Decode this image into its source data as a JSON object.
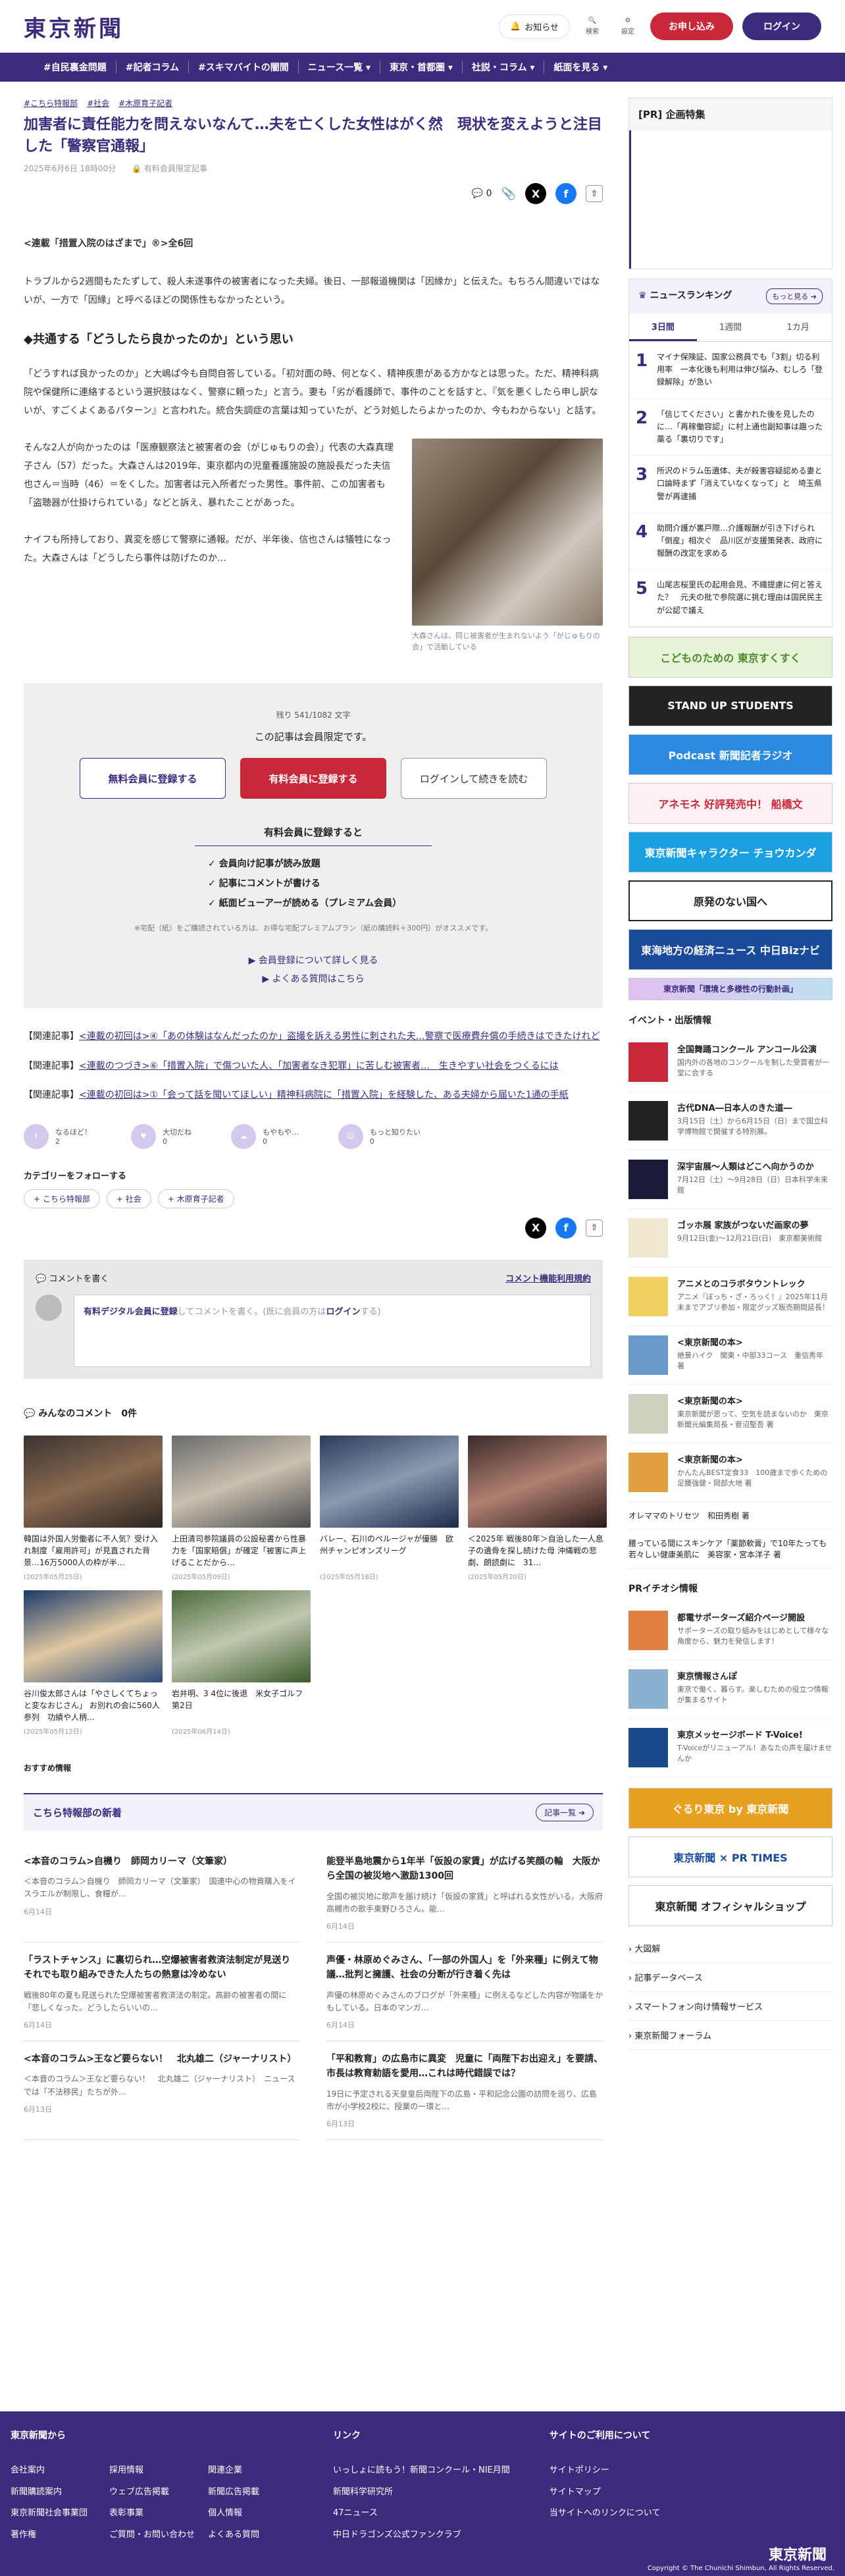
{
  "header": {
    "logo": "東京新聞",
    "notice": "お知らせ",
    "search": "検索",
    "settings": "設定",
    "apply": "お申し込み",
    "login": "ログイン"
  },
  "nav": [
    "#自民裏金問題",
    "#記者コラム",
    "#スキマバイトの闇間",
    "ニュース一覧 ▾",
    "東京・首都圏 ▾",
    "社説・コラム ▾",
    "紙面を見る ▾"
  ],
  "article": {
    "tags": [
      "#こちら特報部",
      "#社会",
      "#木原育子記者"
    ],
    "title": "加害者に責任能力を問えないなんて…夫を亡くした女性はがく然　現状を変えようと注目した「警察官通報」",
    "date": "2025年6月6日 18時00分",
    "member_only": "有料会員限定記事",
    "comment_count": "0",
    "lead": "<連載「措置入院のはざまで」®>全6回",
    "p1": "トラブルから2週間もたたずして、殺人未遂事件の被害者になった夫婦。後日、一部報道機関は「因縁か」と伝えた。もちろん間違いではないが、一方で「因縁」と呼べるほどの関係性もなかったという。",
    "h2": "◆共通する「どうしたら良かったのか」という思い",
    "p2": "「どうすれば良かったのか」と大嶋ぱ今も自問自答している。「初対面の時、何となく、精神疾患がある方かなとは思った。ただ、精神科病院や保健所に連絡するという選択肢はなく、警察に頼った」と言う。妻も「劣が看護師で、事件のことを話すと、『気を悪くしたら申し訳ないが、すごくよくあるパターン』と言われた。統合失調症の言葉は知っていたが、どう対処したらよかったのか、今もわからない」と話す。",
    "p3": "そんな2人が向かったのは「医療観察法と被害者の会（がじゅもりの会）」代表の大森真理子さん（57）だった。大森さんは2019年、東京都内の児童養護施設の施設長だった夫信也さん＝当時（46）＝をくした。加害者は元入所者だった男性。事件前、この加害者も「盗聴器が仕掛けられている」などと訴え、暴れたことがあった。",
    "p4": "ナイフも所持しており、異変を感じて警察に通報。だが、半年後、信也さんは犠牲になった。大森さんは「どうしたら事件は防げたのか…",
    "caption": "大森さんは、同じ被害者が生まれないよう「がじゅもりの会」で活動している"
  },
  "paywall": {
    "remaining": "残り 541/1082 文字",
    "message": "この記事は会員限定です。",
    "free": "無料会員に登録する",
    "paid": "有料会員に登録する",
    "login": "ログインして続きを読む",
    "benefit_title": "有料会員に登録すると",
    "benefits": [
      "会員向け記事が読み放題",
      "記事にコメントが書ける",
      "紙面ビューアーが読める（プレミアム会員）"
    ],
    "note": "※宅配（紙）をご購読されている方は、お得な宅配プレミアムプラン（紙の購読料＋300円）がオススメです。",
    "link1": "▶ 会員登録について詳しく見る",
    "link2": "▶ よくある質問はこちら"
  },
  "related": [
    {
      "prefix": "【関連記事】",
      "text": "<連載の初回は>④「あの体験はなんだったのか」盗撮を訴える男性に刺された夫…警察で医療費弁償の手続きはできたけれど"
    },
    {
      "prefix": "【関連記事】",
      "text": "<連載のつづき>⑥「措置入院」で傷ついた人、「加害者なき犯罪」に苦しむ被害者…　生きやすい社会をつくるには"
    },
    {
      "prefix": "【関連記事】",
      "text": "<連載の初回は>①「会って話を聞いてほしい」精神科病院に「措置入院」を経験した、ある夫婦から届いた1通の手紙"
    }
  ],
  "reactions": [
    {
      "label": "なるほど！",
      "count": "2"
    },
    {
      "label": "大切だね",
      "count": "0"
    },
    {
      "label": "もやもや…",
      "count": "0"
    },
    {
      "label": "もっと知りたい",
      "count": "0"
    }
  ],
  "categories": {
    "title": "カテゴリーをフォローする",
    "chips": [
      "+ こちら特報部",
      "+ 社会",
      "+ 木原育子記者"
    ]
  },
  "comment": {
    "title": "コメントを書く",
    "rules": "コメント機能利用規約",
    "placeholder_link": "有料デジタル会員に登録",
    "placeholder_mid": "してコメントを書く。(既に会員の方は",
    "placeholder_login": "ログイン",
    "placeholder_end": "する)",
    "all": "みんなのコメント",
    "count": "0件"
  },
  "cards": [
    {
      "t": "韓国は外国人労働者に不人気？受け入れ制度「雇用許可」が見直された背景…16万5000人の枠が半…",
      "d": "(2025年05月25日)"
    },
    {
      "t": "上田清司参院議員の公設秘書から性暴力を「国家賠償」が確定「被害に声上げることだから…",
      "d": "(2025年05月09日)"
    },
    {
      "t": "バレー、石川のペルージャが優勝　欧州チャンピオンズリーグ",
      "d": "(2025年05月18日)"
    },
    {
      "t": "＜2025年 戦後80年＞自治した一人息子の遺骨を探し続けた母 沖縄戦の悲劇、朗読劇に　31…",
      "d": "(2025年05月20日)"
    },
    {
      "t": "谷川俊太郎さんは「やさしくてちょっと変なおじさん」 お別れの会に560人参列　功績や人柄…",
      "d": "(2025年05月12日)"
    },
    {
      "t": "岩井明、3 4位に後退　米女子ゴルフ第2日",
      "d": "(2025年06月14日)"
    }
  ],
  "recommend": "おすすめ情報",
  "special": {
    "title": "こちら特報部の新着",
    "more": "記事一覧 ➔",
    "items": [
      {
        "h": "<本音のコラム>自機り　師岡カリーマ（文筆家）",
        "p": "＜本音のコラム＞自機り　師岡カリーマ（文筆家）　国連中心の物資購入をイスラエルが制限し、食糧が…",
        "d": "6月14日"
      },
      {
        "h": "能登半島地震から1年半「仮設の家賃」が広げる笑顔の輪　大阪から全国の被災地へ激励1300回",
        "p": "全国の被災地に歌声を届け続け「仮設の家賃」と呼ばれる女性がいる。大阪府高槻市の歌手東野ひろさん。能…",
        "d": "6月14日"
      },
      {
        "h": "「ラストチャンス」に裏切られ…空爆被害者救済法制定が見送り　それでも取り組みできた人たちの熱意は冷めない",
        "p": "戦後80年の夏も見送られた空爆被害者救済法の制定。高齢の被害者の間に「悲しくなった。どうしたらいいの…",
        "d": "6月14日"
      },
      {
        "h": "声優・林原めぐみさん、「一部の外国人」を「外来種」に例えて物議…批判と擁護、社会の分断が行き着く先は",
        "p": "声優の林原めぐみさんのブログが「外来種」に例えるなどした内容が物議をかもしている。日本のマンガ…",
        "d": "6月14日"
      },
      {
        "h": "<本音のコラム>王など要らない！　北丸雄二（ジャーナリスト）",
        "p": "＜本音のコラム＞王など要らない！　北丸雄二（ジャーナリスト）　ニュースでは「不法移民」たちが外…",
        "d": "6月13日"
      },
      {
        "h": "「平和教育」の広島市に異変　児童に「両陛下お出迎え」を要請、市長は教育勅語を愛用…これは時代錯誤では？",
        "p": "19日に予定される天皇皇后両陛下の広島・平和記念公園の訪問を巡り、広島市が小学校2校に、授業の一環と…",
        "d": "6月13日"
      }
    ]
  },
  "sidebar": {
    "pr_title": "[PR] 企画特集",
    "ranking_title": "ニュースランキング",
    "ranking_more": "もっと見る ➔",
    "tabs": [
      "3日間",
      "1週間",
      "1カ月"
    ],
    "ranks": [
      {
        "n": "1",
        "t": "マイナ保険証、国家公務員でも「3割」切る利用率　一本化後も利用は伸び悩み、むしろ「登録解除」が急い"
      },
      {
        "n": "2",
        "t": "「信じてください」と書かれた後を見したのに…「再稼働容認」に村上通也副知事は趣った藁る「裏切りです」"
      },
      {
        "n": "3",
        "t": "所沢のドラム缶遺体、夫が殺害容疑認める妻と口論時まず「消えていなくなって」と　埼玉県警が再逮捕"
      },
      {
        "n": "4",
        "t": "助問介護が裏戸際…介護報酬が引き下げられ「倒産」相次ぐ　品川区が支援策発表、政府に報酬の改定を求める"
      },
      {
        "n": "5",
        "t": "山尾志桜里氏の起用会見、不織提慮に何と答えた？　元夫の批で参院選に挑む理由は国民民主が公認で議え"
      }
    ],
    "banners": [
      "こどものための 東京すくすく",
      "STAND UP STUDENTS",
      "Podcast 新聞記者ラジオ",
      "アネモネ 好評発売中！ 船橋文",
      "東京新聞キャラクター チョウカンダ",
      "原発のない国へ",
      "東海地方の経済ニュース 中日Bizナビ",
      "東京新聞「環境と多様性の行動計画」"
    ],
    "events_title": "イベント・出版情報",
    "events": [
      {
        "h": "全国舞踊コンクール アンコール公演",
        "p": "国内外の各地のコンクールを制した受賞者が一堂に会する"
      },
      {
        "h": "古代DNA―日本人のきた道―",
        "p": "3月15日（土）から6月15日（日）まで国立科学博物館で開催する特別展。"
      },
      {
        "h": "深宇宙展～人類はどこへ向かうのか",
        "p": "7月12日（土）～9月28日（日）日本科学未来館"
      },
      {
        "h": "ゴッホ展 家族がつないだ画家の夢",
        "p": "9月12日(金)～12月21日(日)　東京都美術館"
      },
      {
        "h": "アニメとのコラボタウントレック",
        "p": "アニメ『ぼっち・ざ・ろっく！』2025年11月末までアプリ参加・限定グッズ販売期間延長！"
      },
      {
        "h": "<東京新聞の本>",
        "p": "絶景ハイク　関東・中部33コース　重信秀年 著"
      },
      {
        "h": "<東京新聞の本>",
        "p": "東京新聞が思って、空気を読まないのか　東京新聞元編集局長・菅沼堅吾 著"
      },
      {
        "h": "<東京新聞の本>",
        "p": "かんたんBEST定食33　100歳まで歩くための　足腰強健・岡部大地 著"
      }
    ],
    "ev_more1": "オレママのトリセツ　和田秀樹 著",
    "ev_more2": "腰っている間にスキンケア「薬節軟膏」で10年たっても若々しい健康美肌に　美容家・宮本洋子 著",
    "pr2_title": "PRイチオシ情報",
    "pr2": [
      {
        "h": "都電サポーターズ紹介ページ開設",
        "p": "サポーターズの取り組みをはじめとして様々な角度から、魅力を発信します！"
      },
      {
        "h": "東京情報さんぽ",
        "p": "東京で働く、暮らす。楽しむための役立つ情報が集まるサイト"
      },
      {
        "h": "東京メッセージボード T-Voice!",
        "p": "T-Voiceがリニューアル！あなたの声を届けませんか"
      }
    ],
    "pr_banners": [
      "ぐるり東京 by 東京新聞",
      "東京新聞 × PR TIMES",
      "東京新聞 オフィシャルショップ"
    ],
    "links": [
      "大図解",
      "記事データベース",
      "スマートフォン向け情報サービス",
      "東京新聞フォーラム"
    ]
  },
  "footer": {
    "col1_title": "東京新聞から",
    "col1": [
      "会社案内",
      "採用情報",
      "関連企業",
      "新聞購読案内",
      "ウェブ広告掲載",
      "新聞広告掲載",
      "東京新聞社会事業団",
      "表彰事業",
      "個人情報",
      "著作権",
      "ご質問・お問い合わせ",
      "よくある質問"
    ],
    "col2_title": "リンク",
    "col2": [
      "いっしょに読もう！新聞コンクール・NIE月間",
      "新聞科学研究所",
      "47ニュース",
      "中日ドラゴンズ公式ファンクラブ"
    ],
    "col3_title": "サイトのご利用について",
    "col3": [
      "サイトポリシー",
      "サイトマップ",
      "当サイトへのリンクについて"
    ],
    "logo": "東京新聞",
    "copyright": "Copyright © The Chunichi Shimbun, All Rights Reserved."
  }
}
